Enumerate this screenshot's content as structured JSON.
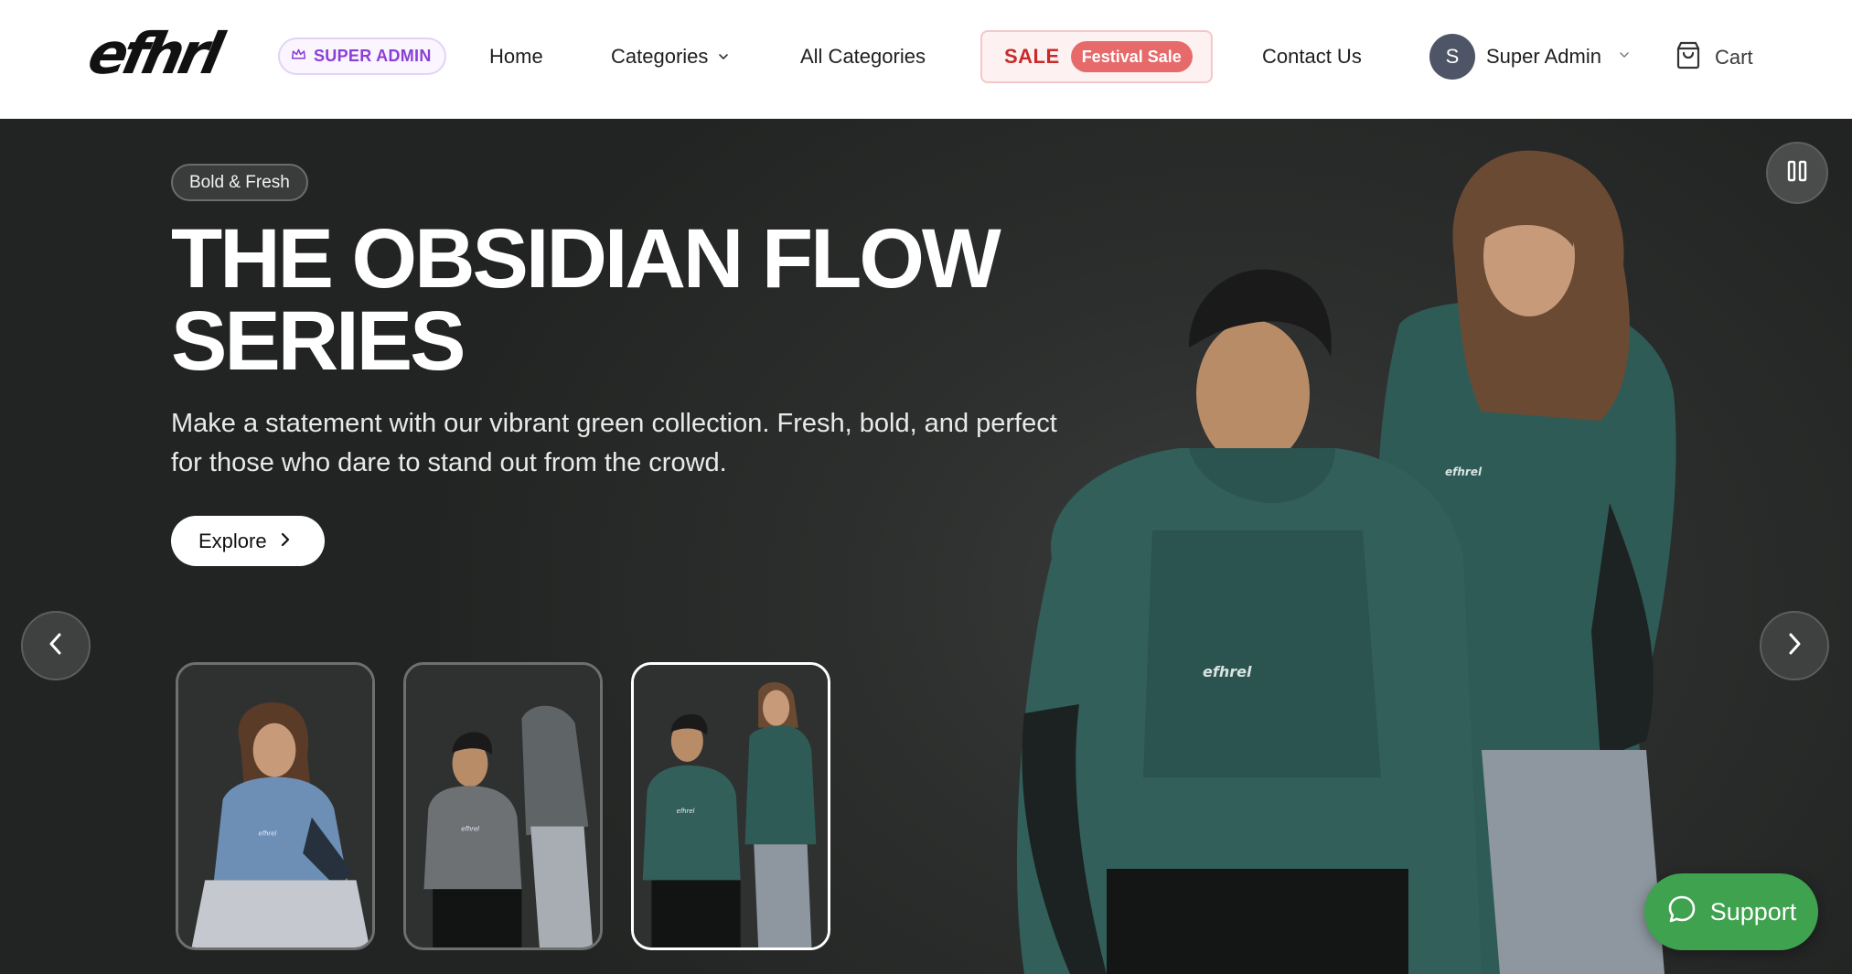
{
  "header": {
    "logo_text": "efhrl",
    "admin_badge": "SUPER ADMIN",
    "nav": {
      "home": "Home",
      "categories": "Categories",
      "all_categories": "All Categories",
      "contact": "Contact Us"
    },
    "sale": {
      "label": "SALE",
      "chip": "Festival Sale"
    },
    "user": {
      "initial": "S",
      "name": "Super Admin"
    },
    "cart_label": "Cart"
  },
  "hero": {
    "tag": "Bold & Fresh",
    "title_line1": "THE OBSIDIAN FLOW",
    "title_line2": "SERIES",
    "description": "Make a statement with our vibrant green collection. Fresh, bold, and perfect for those who dare to stand out from the crowd.",
    "explore_label": "Explore",
    "active_slide": 3,
    "thumbnails": [
      "Woman in blue hoodie seated",
      "Two models in grey hoodies",
      "Two models in green hoodies"
    ]
  },
  "support_label": "Support",
  "colors": {
    "sale_red": "#c92a2a",
    "sale_chip": "#e66a6a",
    "admin_purple": "#8b3fd6",
    "support_green": "#3fa24f",
    "hoodie_green": "#2f5b57",
    "hero_bg": "#2d2f2e"
  },
  "icons": [
    "crown-icon",
    "chevron-down-icon",
    "cart-icon",
    "pause-icon",
    "chevron-left-icon",
    "chevron-right-icon",
    "chat-bubble-icon"
  ]
}
